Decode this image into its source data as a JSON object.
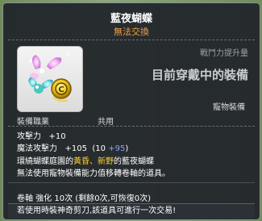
{
  "item": {
    "name": "藍夜蝴蝶",
    "trade_status": "無法交換",
    "power_up_label": "戰鬥力提升量",
    "currently_wearing": "目前穿戴中的裝備",
    "pet_equipment": "寵物裝備",
    "job_label": "裝備職業",
    "job_value": "共用"
  },
  "stats": {
    "attack_label": "攻擊力",
    "attack_value": "+10",
    "magic_label": "魔法攻擊力",
    "magic_value": "+105",
    "magic_base_open": "(10",
    "magic_bonus": "+95",
    "magic_close": ")"
  },
  "description": {
    "line1_prefix": "環繞蝴蝶庭園的",
    "line1_gold": "黃昏、新野",
    "line1_suffix": "的藍夜蝴蝶",
    "line2": "無法使用寵物裝備能力值移轉卷軸的道具。"
  },
  "upgrade": {
    "label": "卷軸 強化",
    "count": "10次",
    "detail": "(剩餘0次,可恢復0次)"
  },
  "footer": {
    "text": "若使用時裝神奇剪刀,該道具可進行一次交易!"
  },
  "colors": {
    "trade_status": "#f0a040",
    "bonus": "#8aa0ff",
    "highlight": "#ffcc33"
  }
}
